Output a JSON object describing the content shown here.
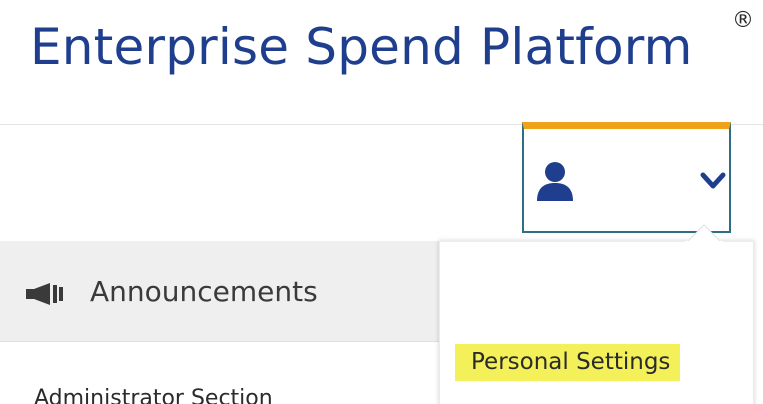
{
  "header": {
    "title": "Enterprise Spend Platform",
    "registered_mark": "®"
  },
  "user_menu": {
    "user_icon": "user-icon",
    "chevron_icon": "chevron-down-icon",
    "accent_color": "#f0a21b",
    "border_color": "#2e6f86",
    "items": [
      {
        "label": "Personal Settings",
        "highlight_color": "#f3f05a"
      }
    ]
  },
  "announcements": {
    "icon": "megaphone-icon",
    "label": "Announcements"
  },
  "admin": {
    "label": "Administrator Section"
  }
}
